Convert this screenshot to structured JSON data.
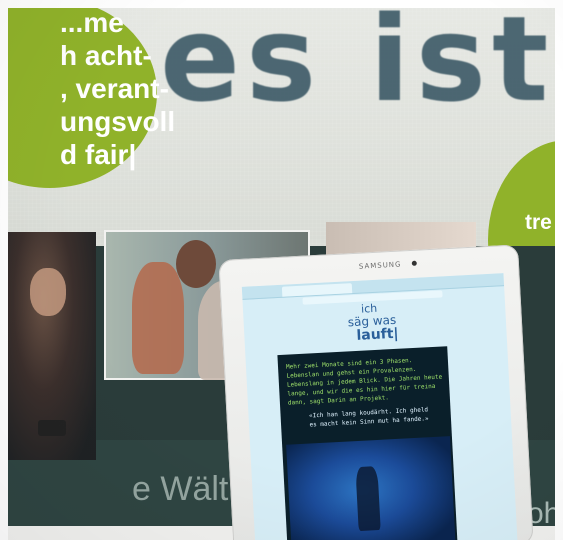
{
  "wall": {
    "headline": "es ist a"
  },
  "circle_left": {
    "text": "...me\nh acht-\n, verant-\nungsvoll\nd fair|"
  },
  "circle_right": {
    "text": "tre\nwe\nis\nn"
  },
  "panel": {
    "walt_text": "e Wält",
    "oh_text": "oh"
  },
  "tablet": {
    "brand": "SAMSUNG",
    "logo": {
      "line1": "ich",
      "line2": "säg was",
      "line3": "lauft|"
    },
    "article": {
      "paragraph": "Mehr zwei Monate sind ein 3 Phasen. Lebenslan und gehst ein Provalenzen. Lebenslang in jedem Blick. Die Jahren heute lange, und wir die es hin hier für treina dann, sagt Darin an Projekt.",
      "quote": "«Ich han lang koudärht. Ich gheld es macht kein Sinn mut ha fande.»"
    }
  },
  "colors": {
    "accent_green": "#90b22a",
    "wall_text": "#2b4b5a",
    "dark_panel": "#2a3c3a",
    "tablet_screen": "#d7eef7",
    "article_bg": "#0a1f2a",
    "article_text": "#9ee16a",
    "logo_blue": "#2a5f9a"
  }
}
